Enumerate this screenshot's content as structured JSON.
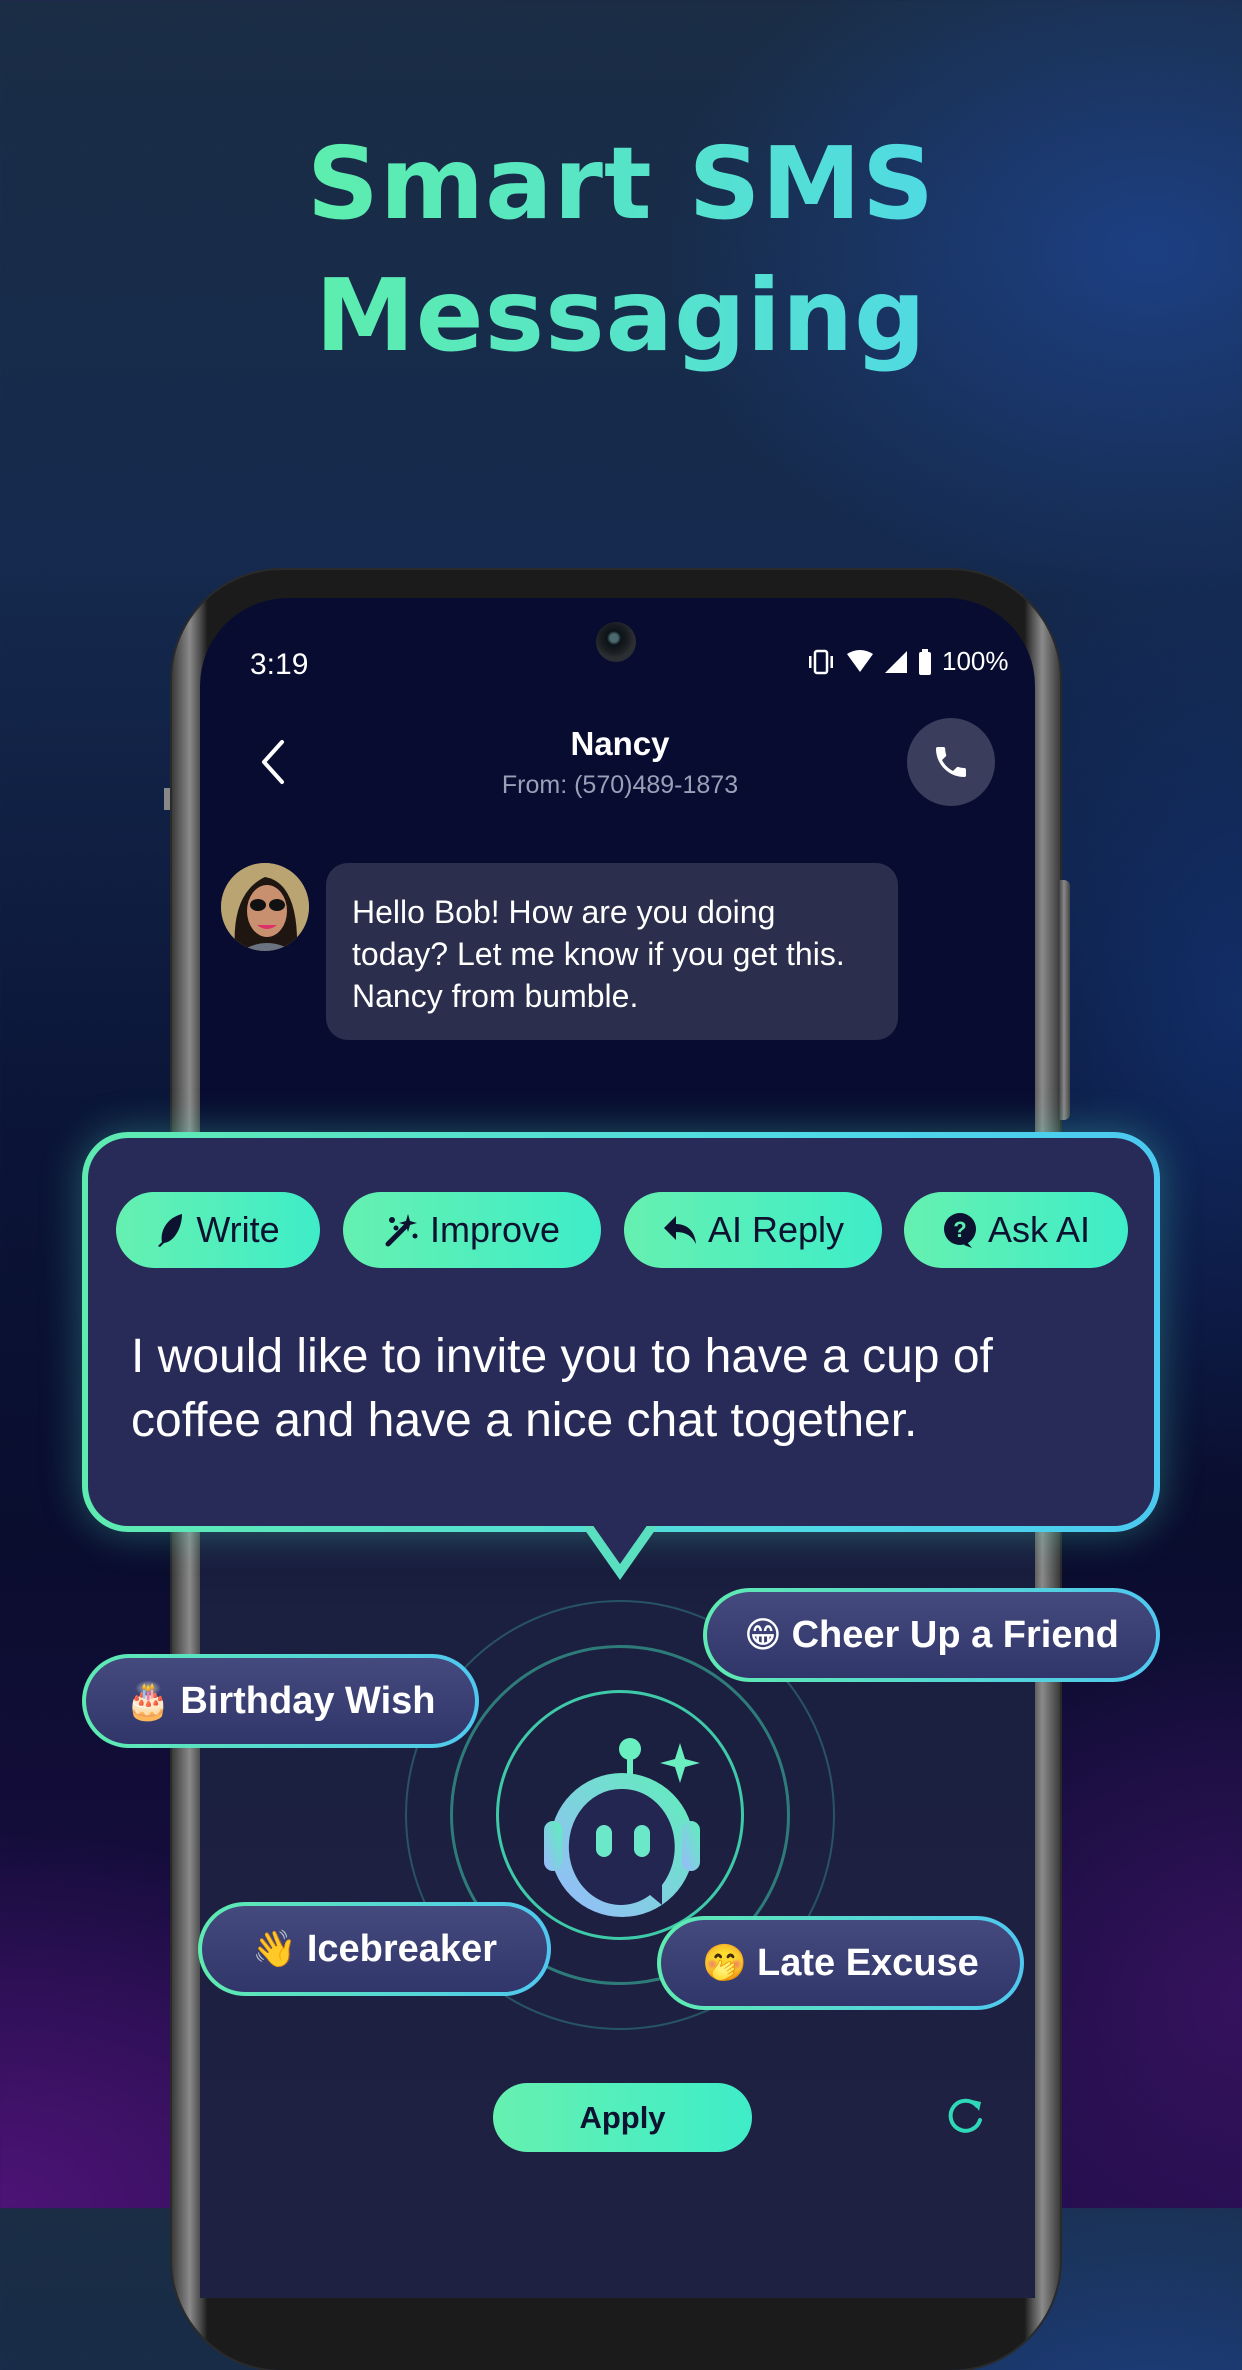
{
  "headline": {
    "line1": "Smart SMS",
    "line2": "Messaging"
  },
  "status_bar": {
    "time": "3:19",
    "battery": "100%",
    "icons": [
      "vibrate-icon",
      "wifi-icon",
      "signal-icon",
      "battery-icon"
    ]
  },
  "header": {
    "contact_name": "Nancy",
    "contact_number": "From: (570)489-1873",
    "back_icon": "chevron-left-icon",
    "call_icon": "phone-icon"
  },
  "conversation": {
    "incoming_message": "Hello Bob! How are you doing today? Let me know if you get this. Nancy from bumble."
  },
  "ai_panel": {
    "actions": [
      {
        "label": "Write",
        "icon": "feather-icon"
      },
      {
        "label": "Improve",
        "icon": "magic-wand-icon"
      },
      {
        "label": "AI Reply",
        "icon": "reply-icon"
      },
      {
        "label": "Ask AI",
        "icon": "question-bubble-icon"
      }
    ],
    "generated_text": "I would like to invite you to have a cup of coffee and have a nice chat together."
  },
  "suggestions": [
    {
      "emoji": "😁",
      "label": "Cheer Up a Friend"
    },
    {
      "emoji": "🎂",
      "label": "Birthday Wish"
    },
    {
      "emoji": "👋",
      "label": "Icebreaker"
    },
    {
      "emoji": "🤭",
      "label": "Late Excuse"
    }
  ],
  "footer": {
    "apply_label": "Apply",
    "refresh_icon": "refresh-icon"
  },
  "colors": {
    "accent_green": "#5EEBB0",
    "accent_cyan": "#4FD8E8",
    "panel_bg": "#282B57",
    "screen_bg": "#080C30"
  }
}
